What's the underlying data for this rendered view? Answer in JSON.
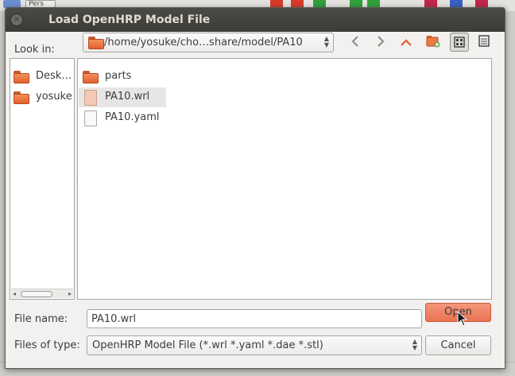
{
  "background_app": {
    "partial_combo_text": "Pers"
  },
  "dialog": {
    "title": "Load OpenHRP Model File",
    "look_in_label": "Look in:",
    "path": "/home/yosuke/cho…share/model/PA10",
    "places": [
      {
        "label": "Desk…",
        "icon": "folder-icon"
      },
      {
        "label": "yosuke",
        "icon": "folder-icon"
      }
    ],
    "files": [
      {
        "name": "parts",
        "icon": "folder-icon",
        "selected": false
      },
      {
        "name": "PA10.wrl",
        "icon": "vrml-file-icon",
        "selected": true
      },
      {
        "name": "PA10.yaml",
        "icon": "text-file-icon",
        "selected": false
      }
    ],
    "file_name_label": "File name:",
    "file_name_value": "PA10.wrl",
    "files_of_type_label": "Files of type:",
    "files_of_type_value": "OpenHRP Model File (*.wrl *.yaml *.dae *.stl)",
    "open_label": "Open",
    "cancel_label": "Cancel"
  },
  "colors": {
    "titlebar": "#3c3b37",
    "accent": "#ea7253",
    "folder": "#e1612c",
    "selection": "#e8e6e4"
  }
}
